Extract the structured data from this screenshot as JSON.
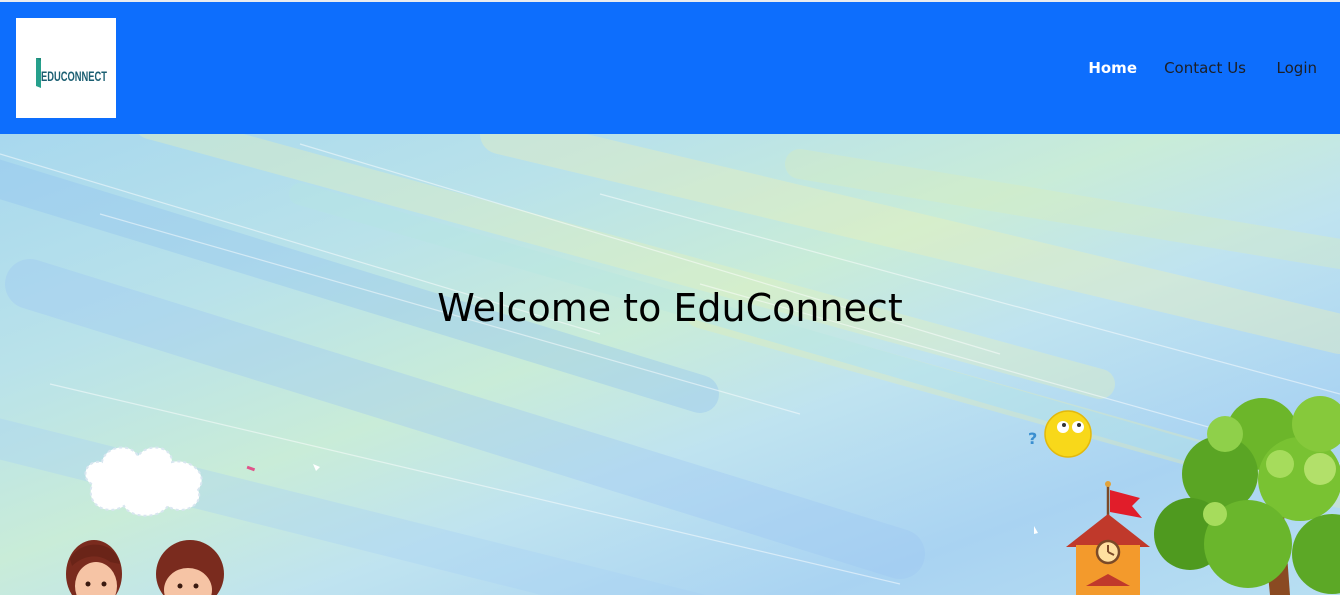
{
  "header": {
    "logo_text": "EDUCONNECT",
    "nav": [
      {
        "label": "Home",
        "active": true
      },
      {
        "label": "Contact Us",
        "active": false
      },
      {
        "label": "Login",
        "active": false
      }
    ]
  },
  "hero": {
    "title": "Welcome to EduConnect"
  },
  "colors": {
    "navbar": "#0d6efd",
    "active_link": "#ffffff",
    "link": "#1d1f24"
  }
}
